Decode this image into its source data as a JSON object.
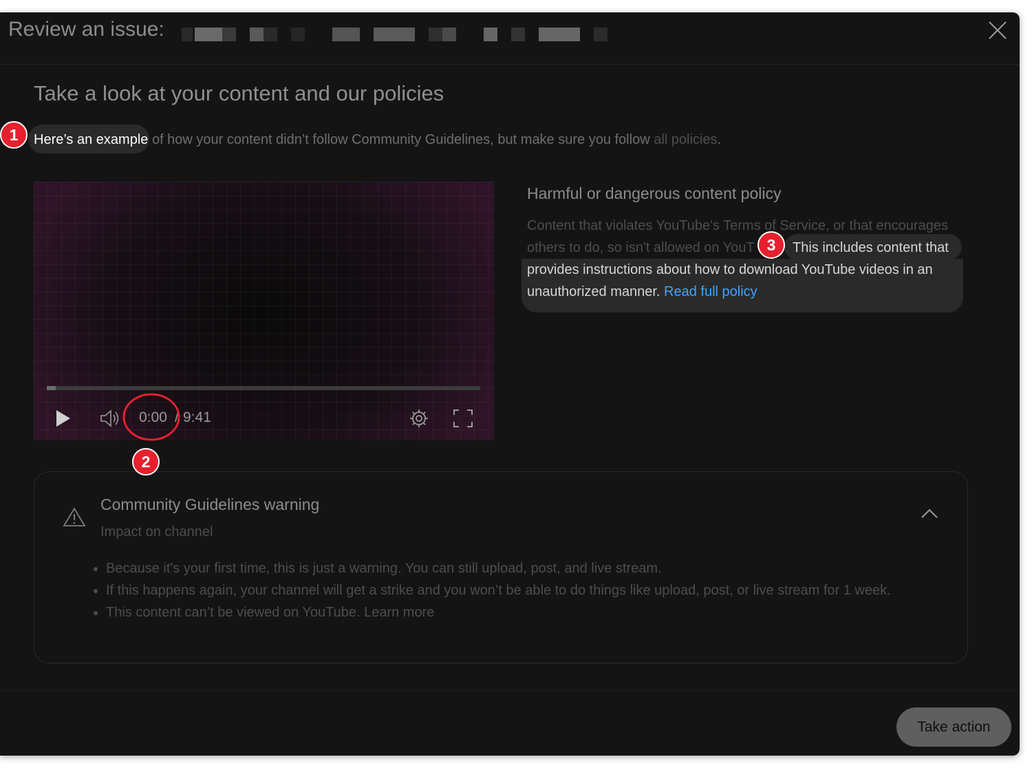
{
  "dialog": {
    "title": "Review an issue:",
    "close_icon": "close-icon"
  },
  "content": {
    "section_title": "Take a look at your content and our policies",
    "intro_highlight": "Here’s an example",
    "intro_rest": " of how your content didn’t follow Community Guidelines, but make sure you follow ",
    "intro_link": "all policies",
    "intro_end": "."
  },
  "player": {
    "current_time": "0:00",
    "separator": "/",
    "duration": "9:41",
    "progress": 0.02,
    "icons": [
      "play-icon",
      "volume-icon",
      "settings-gear-icon",
      "fullscreen-icon"
    ]
  },
  "policy": {
    "title": "Harmful or dangerous content policy",
    "body_line1": "Content that violates YouTube's Terms of Service, or that encourages",
    "body_line2": "others to do, so isn't allowed on YouT",
    "highlight_line1": "This includes content that",
    "highlight_line2": "provides instructions about how to download YouTube videos in an",
    "highlight_line3": "unauthorized manner. ",
    "read_link": "Read full policy",
    "link_color": "#3ea6ff"
  },
  "warning": {
    "title": "Community Guidelines warning",
    "subtitle": "Impact on channel",
    "icons": [
      "warning-triangle-icon",
      "chevron-up-icon"
    ],
    "bullets": [
      "Because it's your first time, this is just a warning. You can still upload, post, and live stream.",
      "If this happens again, your channel will get a strike and you won’t be able to do things like upload, post, or live stream for 1 week.",
      "This content can’t be viewed on YouTube. Learn more"
    ]
  },
  "footer": {
    "take_action": "Take action"
  },
  "annotations": {
    "badge_1": "1",
    "badge_2": "2",
    "badge_3": "3",
    "badge_color": "#e8202e"
  }
}
